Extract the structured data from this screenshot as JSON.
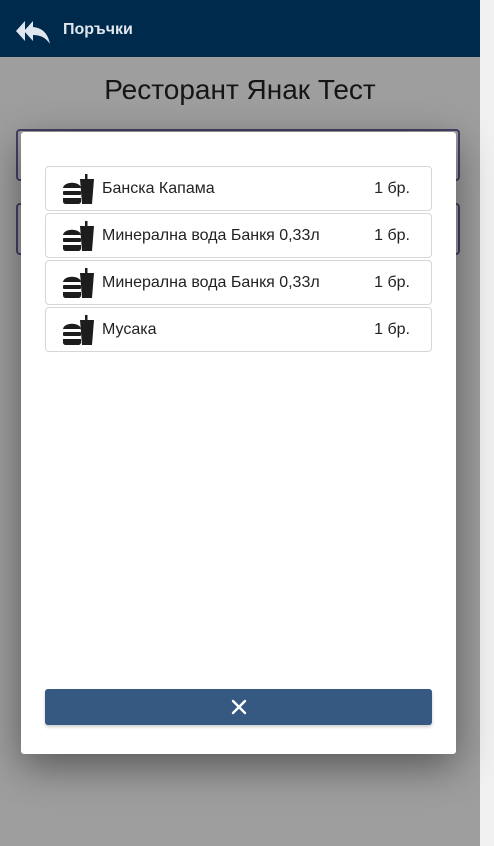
{
  "header": {
    "title": "Поръчки",
    "back_icon": "double-reply-arrow-icon"
  },
  "restaurant": {
    "name": "Ресторант Янак Тест"
  },
  "orders": [
    {
      "name": "Банска Капама",
      "qty": "1 бр.",
      "icon": "burger-drink-icon"
    },
    {
      "name": "Минерална вода Банкя 0,33л",
      "qty": "1 бр.",
      "icon": "burger-drink-icon"
    },
    {
      "name": "Минерална вода Банкя 0,33л",
      "qty": "1 бр.",
      "icon": "burger-drink-icon"
    },
    {
      "name": "Мусака",
      "qty": "1 бр.",
      "icon": "burger-drink-icon"
    }
  ],
  "dialog": {
    "close_icon": "close-icon"
  },
  "colors": {
    "header": "#002a4c",
    "button": "#355981",
    "card_border": "#6b6aa6"
  }
}
